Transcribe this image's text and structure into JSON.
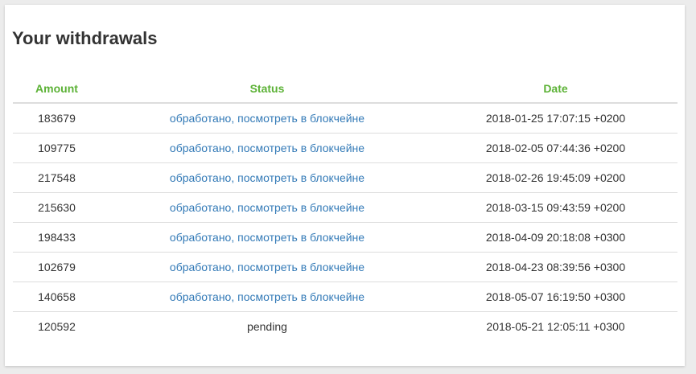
{
  "page": {
    "title": "Your withdrawals"
  },
  "table": {
    "headers": {
      "amount": "Amount",
      "status": "Status",
      "date": "Date"
    },
    "rows": [
      {
        "amount": "183679",
        "status": "обработано, посмотреть в блокчейне",
        "status_is_link": true,
        "date": "2018-01-25 17:07:15 +0200"
      },
      {
        "amount": "109775",
        "status": "обработано, посмотреть в блокчейне",
        "status_is_link": true,
        "date": "2018-02-05 07:44:36 +0200"
      },
      {
        "amount": "217548",
        "status": "обработано, посмотреть в блокчейне",
        "status_is_link": true,
        "date": "2018-02-26 19:45:09 +0200"
      },
      {
        "amount": "215630",
        "status": "обработано, посмотреть в блокчейне",
        "status_is_link": true,
        "date": "2018-03-15 09:43:59 +0200"
      },
      {
        "amount": "198433",
        "status": "обработано, посмотреть в блокчейне",
        "status_is_link": true,
        "date": "2018-04-09 20:18:08 +0300"
      },
      {
        "amount": "102679",
        "status": "обработано, посмотреть в блокчейне",
        "status_is_link": true,
        "date": "2018-04-23 08:39:56 +0300"
      },
      {
        "amount": "140658",
        "status": "обработано, посмотреть в блокчейне",
        "status_is_link": true,
        "date": "2018-05-07 16:19:50 +0300"
      },
      {
        "amount": "120592",
        "status": "pending",
        "status_is_link": false,
        "date": "2018-05-21 12:05:11 +0300"
      }
    ]
  },
  "colors": {
    "header_text": "#5cb236",
    "link": "#337ab7",
    "text": "#333333"
  }
}
